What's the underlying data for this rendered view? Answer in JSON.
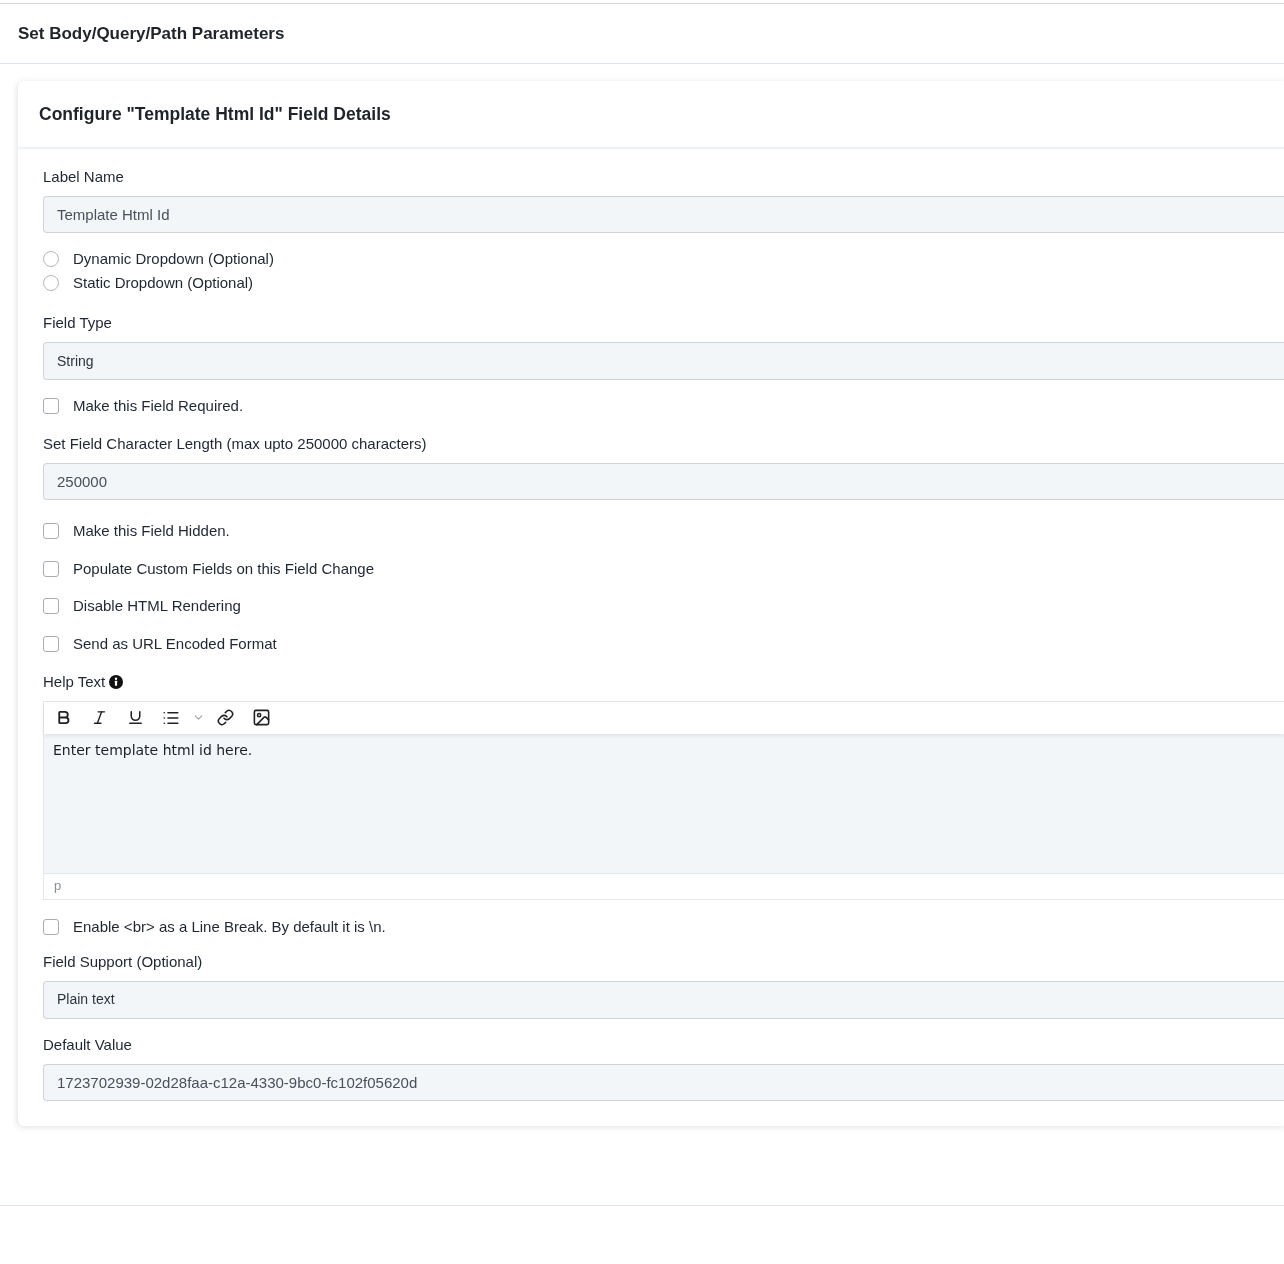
{
  "header": {
    "title": "Set Body/Query/Path Parameters"
  },
  "card": {
    "title": "Configure \"Template Html Id\" Field Details",
    "fields": [
      {
        "kind": "input",
        "label": "Label Name",
        "value": "Template Html Id"
      },
      {
        "kind": "radio_group",
        "options": [
          {
            "label": "Dynamic Dropdown (Optional)",
            "selected": false
          },
          {
            "label": "Static Dropdown (Optional)",
            "selected": false
          }
        ]
      },
      {
        "kind": "select",
        "label": "Field Type",
        "value": "String"
      },
      {
        "kind": "checkbox",
        "label": "Make this Field Required.",
        "checked": false
      },
      {
        "kind": "input",
        "label": "Set Field Character Length (max upto 250000 characters)",
        "value": "250000"
      },
      {
        "kind": "checkbox",
        "label": "Make this Field Hidden.",
        "checked": false
      },
      {
        "kind": "checkbox",
        "label": "Populate Custom Fields on this Field Change",
        "checked": false
      },
      {
        "kind": "checkbox",
        "label": "Disable HTML Rendering",
        "checked": false
      },
      {
        "kind": "checkbox",
        "label": "Send as URL Encoded Format",
        "checked": false
      },
      {
        "kind": "editor",
        "label": "Help Text",
        "content": "Enter template html id here.",
        "path": "p"
      },
      {
        "kind": "checkbox",
        "label": "Enable <br> as a Line Break. By default it is \\n.",
        "checked": false
      },
      {
        "kind": "select",
        "label": "Field Support (Optional)",
        "value": "Plain text"
      },
      {
        "kind": "input",
        "label": "Default Value",
        "value": "1723702939-02d28faa-c12a-4330-9bc0-fc102f05620d"
      }
    ]
  }
}
